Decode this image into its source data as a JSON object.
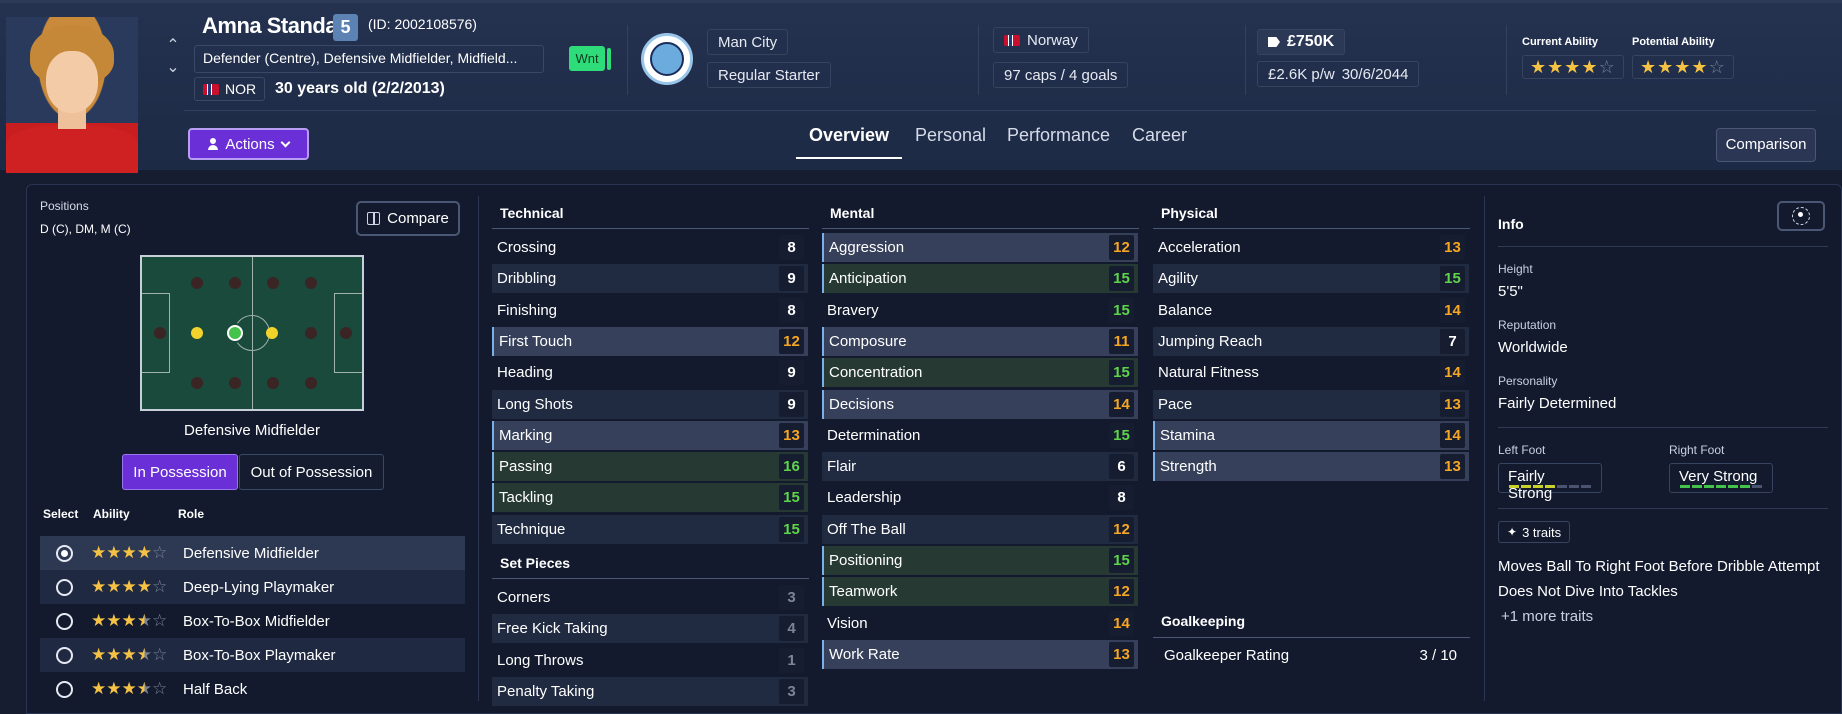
{
  "header": {
    "name": "Amna Standal",
    "squad_number": "5",
    "player_id": "(ID: 2002108576)",
    "positions": "Defender (Centre), Defensive Midfielder, Midfield...",
    "nationality_code": "NOR",
    "age": "30 years old (2/2/2013)",
    "status_tag": "Wnt",
    "club": "Man City",
    "squad_status": "Regular Starter",
    "nation": "Norway",
    "caps_goals": "97 caps / 4 goals",
    "value": "£750K",
    "wage": "£2.6K p/w",
    "contract_end": "30/6/2044",
    "current_ability_label": "Current Ability",
    "potential_ability_label": "Potential Ability",
    "current_ability_stars": 4,
    "potential_ability_stars": 4,
    "actions_label": "Actions",
    "tabs": [
      "Overview",
      "Personal",
      "Performance",
      "Career"
    ],
    "active_tab": "Overview",
    "comparison_label": "Comparison"
  },
  "positions_panel": {
    "label": "Positions",
    "value": "D (C), DM, M (C)",
    "compare_label": "Compare",
    "selected_role": "Defensive Midfielder",
    "in_possession": "In Possession",
    "out_of_possession": "Out of Possession",
    "col_select": "Select",
    "col_ability": "Ability",
    "col_role": "Role",
    "roles": [
      {
        "name": "Defensive Midfielder",
        "stars": 4,
        "selected": true
      },
      {
        "name": "Deep-Lying Playmaker",
        "stars": 4,
        "selected": false
      },
      {
        "name": "Box-To-Box Midfielder",
        "stars": 3.5,
        "selected": false
      },
      {
        "name": "Box-To-Box Playmaker",
        "stars": 3.5,
        "selected": false
      },
      {
        "name": "Half Back",
        "stars": 3.5,
        "selected": false
      }
    ]
  },
  "technical": {
    "title": "Technical",
    "attrs": [
      {
        "name": "Crossing",
        "value": "8"
      },
      {
        "name": "Dribbling",
        "value": "9"
      },
      {
        "name": "Finishing",
        "value": "8"
      },
      {
        "name": "First Touch",
        "value": "12"
      },
      {
        "name": "Heading",
        "value": "9"
      },
      {
        "name": "Long Shots",
        "value": "9"
      },
      {
        "name": "Marking",
        "value": "13"
      },
      {
        "name": "Passing",
        "value": "16"
      },
      {
        "name": "Tackling",
        "value": "15"
      },
      {
        "name": "Technique",
        "value": "15"
      }
    ]
  },
  "set_pieces": {
    "title": "Set Pieces",
    "attrs": [
      {
        "name": "Corners",
        "value": "3"
      },
      {
        "name": "Free Kick Taking",
        "value": "4"
      },
      {
        "name": "Long Throws",
        "value": "1"
      },
      {
        "name": "Penalty Taking",
        "value": "3"
      }
    ]
  },
  "mental": {
    "title": "Mental",
    "attrs": [
      {
        "name": "Aggression",
        "value": "12"
      },
      {
        "name": "Anticipation",
        "value": "15"
      },
      {
        "name": "Bravery",
        "value": "15"
      },
      {
        "name": "Composure",
        "value": "11"
      },
      {
        "name": "Concentration",
        "value": "15"
      },
      {
        "name": "Decisions",
        "value": "14"
      },
      {
        "name": "Determination",
        "value": "15"
      },
      {
        "name": "Flair",
        "value": "6"
      },
      {
        "name": "Leadership",
        "value": "8"
      },
      {
        "name": "Off The Ball",
        "value": "12"
      },
      {
        "name": "Positioning",
        "value": "15"
      },
      {
        "name": "Teamwork",
        "value": "12"
      },
      {
        "name": "Vision",
        "value": "14"
      },
      {
        "name": "Work Rate",
        "value": "13"
      }
    ]
  },
  "physical": {
    "title": "Physical",
    "attrs": [
      {
        "name": "Acceleration",
        "value": "13"
      },
      {
        "name": "Agility",
        "value": "15"
      },
      {
        "name": "Balance",
        "value": "14"
      },
      {
        "name": "Jumping Reach",
        "value": "7"
      },
      {
        "name": "Natural Fitness",
        "value": "14"
      },
      {
        "name": "Pace",
        "value": "13"
      },
      {
        "name": "Stamina",
        "value": "14"
      },
      {
        "name": "Strength",
        "value": "13"
      }
    ]
  },
  "goalkeeping": {
    "title": "Goalkeeping",
    "rating_label": "Goalkeeper Rating",
    "rating_value": "3 / 10"
  },
  "info": {
    "title": "Info",
    "height_label": "Height",
    "height": "5'5\"",
    "reputation_label": "Reputation",
    "reputation": "Worldwide",
    "personality_label": "Personality",
    "personality": "Fairly Determined",
    "left_foot_label": "Left Foot",
    "left_foot": "Fairly Strong",
    "left_foot_level": 4,
    "right_foot_label": "Right Foot",
    "right_foot": "Very Strong",
    "right_foot_level": 6,
    "traits_count": "3 traits",
    "traits": [
      "Moves Ball To Right Foot Before Dribble Attempt",
      "Does Not Dive Into Tackles"
    ],
    "more_traits": "+1 more traits"
  },
  "colors": {
    "accent": "#6a2fd6",
    "value_high": "#5fd34a",
    "value_mid": "#f5a623",
    "value_low": "#7c8497",
    "star": "#f5c244"
  }
}
